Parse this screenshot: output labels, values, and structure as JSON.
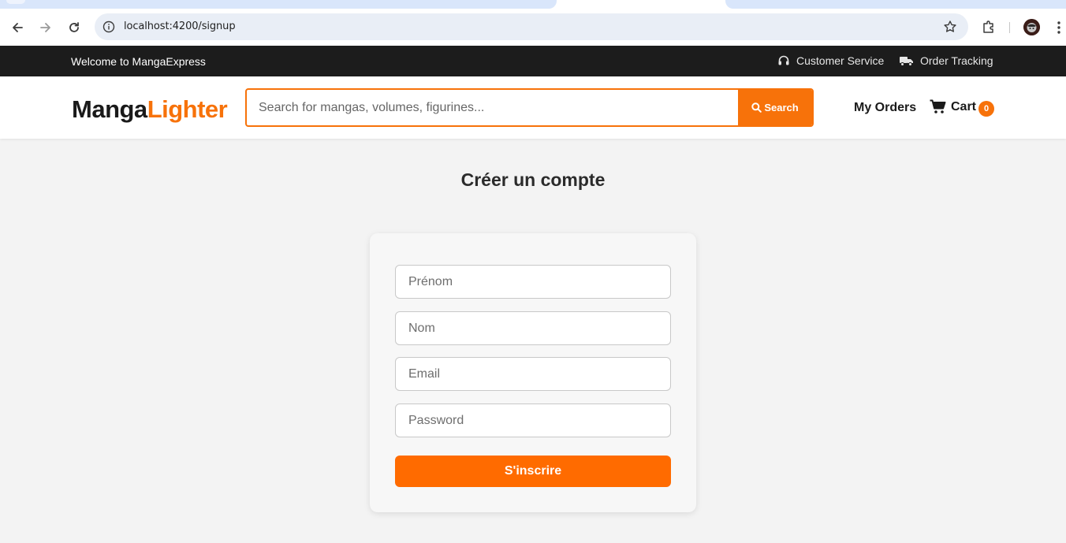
{
  "browser": {
    "url": "localhost:4200/signup"
  },
  "topbar": {
    "welcome": "Welcome to MangaExpress",
    "customer_service": "Customer Service",
    "order_tracking": "Order Tracking"
  },
  "header": {
    "logo_part1": "Manga",
    "logo_part2": "Lighter",
    "search_placeholder": "Search for mangas, volumes, figurines...",
    "search_button": "Search",
    "my_orders": "My Orders",
    "cart_label": "Cart",
    "cart_count": "0"
  },
  "signup": {
    "title": "Créer un compte",
    "first_name_placeholder": "Prénom",
    "last_name_placeholder": "Nom",
    "email_placeholder": "Email",
    "password_placeholder": "Password",
    "submit_label": "S'inscrire"
  },
  "colors": {
    "accent": "#f7720a",
    "topbar_bg": "#1c1c1c",
    "page_bg": "#f3f3f3"
  }
}
